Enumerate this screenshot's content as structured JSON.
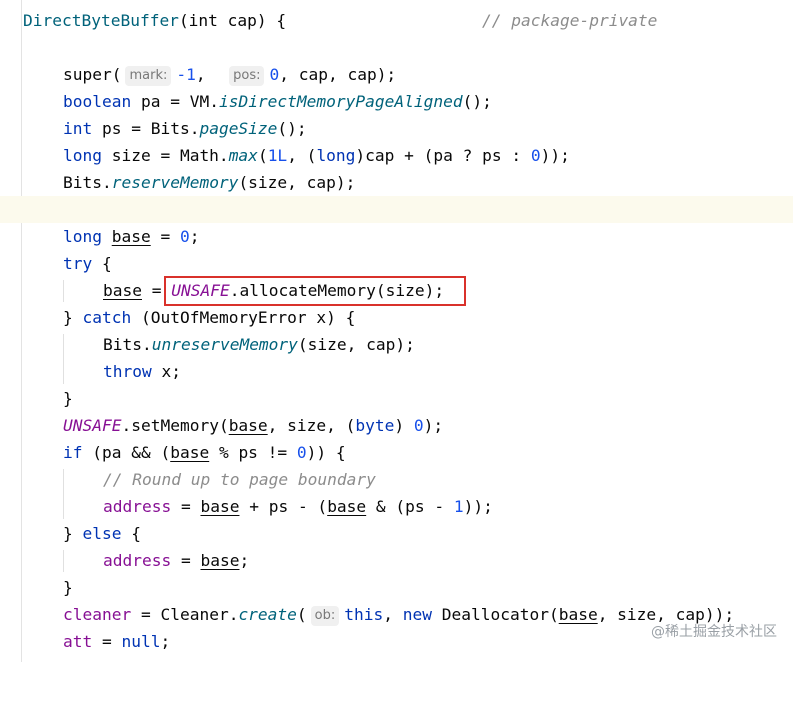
{
  "header": {
    "signature": "DirectByteBuffer(int cap) {",
    "comment": "// package-private",
    "name": "DirectByteBuffer",
    "params": "(int cap) {"
  },
  "lines": {
    "l1": {
      "pre": "super(",
      "hint1": "mark:",
      "a1": "-1",
      "sep1": ",  ",
      "hint2": "pos:",
      "a2": "0",
      "rest": ", cap, cap);"
    },
    "l2": {
      "kw": "boolean",
      "a": " pa = VM.",
      "fn": "isDirectMemoryPageAligned",
      "b": "();"
    },
    "l3": {
      "kw": "int",
      "a": " ps = Bits.",
      "fn": "pageSize",
      "b": "();"
    },
    "l4": {
      "kw": "long",
      "a": " size = Math.",
      "fn": "max",
      "b": "(",
      "n1": "1L",
      "c": ", (",
      "kw2": "long",
      "d": ")cap + (pa ? ps : ",
      "n2": "0",
      "e": "));"
    },
    "l5": {
      "a": "Bits.",
      "fn": "reserveMemory",
      "b": "(size, cap);"
    },
    "l7": {
      "kw": "long",
      "sp": " ",
      "var": "base",
      "a": " = ",
      "n": "0",
      "b": ";"
    },
    "l8": {
      "kw": "try",
      "a": " {"
    },
    "l9": {
      "var": "base",
      "a": " = ",
      "field": "UNSAFE",
      "b": ".allocateMemory(size);"
    },
    "l10": {
      "a": "} ",
      "kw": "catch",
      "b": " (OutOfMemoryError x) {"
    },
    "l11": {
      "a": "Bits.",
      "fn": "unreserveMemory",
      "b": "(size, cap);"
    },
    "l12": {
      "kw": "throw",
      "a": " x;"
    },
    "l13": {
      "a": "}"
    },
    "l14": {
      "field": "UNSAFE",
      "a": ".setMemory(",
      "var": "base",
      "b": ", size, (",
      "kw": "byte",
      "c": ") ",
      "n": "0",
      "d": ");"
    },
    "l15": {
      "kw": "if",
      "a": " (pa && (",
      "var": "base",
      "b": " % ps != ",
      "n": "0",
      "c": ")) {"
    },
    "l16": {
      "comment": "// Round up to page boundary"
    },
    "l17": {
      "field": "address",
      "a": " = ",
      "var1": "base",
      "b": " + ps - (",
      "var2": "base",
      "c": " & (ps - ",
      "n": "1",
      "d": "));"
    },
    "l18": {
      "a": "} ",
      "kw": "else",
      "b": " {"
    },
    "l19": {
      "field": "address",
      "a": " = ",
      "var": "base",
      "b": ";"
    },
    "l20": {
      "a": "}"
    },
    "l21": {
      "field": "cleaner",
      "a": " = Cleaner.",
      "fn": "create",
      "b": "(",
      "hint": "ob:",
      "kw1": "this",
      "c": ", ",
      "kw2": "new",
      "d": " Deallocator(",
      "var": "base",
      "e": ", size, cap));"
    },
    "l22": {
      "field": "att",
      "a": " = ",
      "kw": "null",
      "b": ";"
    }
  },
  "watermark": "@稀土掘金技术社区",
  "colors": {
    "keyword": "#0033b3",
    "number": "#1750eb",
    "method": "#00627a",
    "field": "#871094",
    "comment": "#8c8c8c",
    "highlight_box": "#d9312b"
  }
}
